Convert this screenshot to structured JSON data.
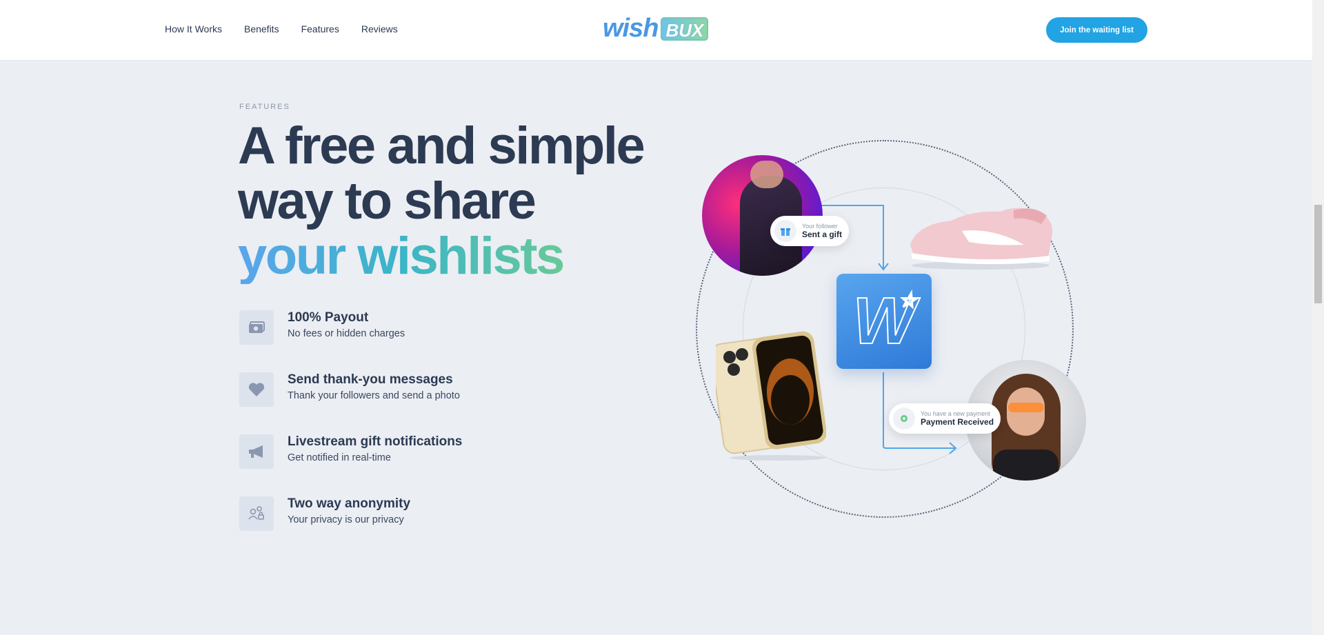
{
  "header": {
    "nav": [
      "How It Works",
      "Benefits",
      "Features",
      "Reviews"
    ],
    "logo": {
      "wish": "wish",
      "bux": "BUX"
    },
    "cta_label": "Join the waiting list"
  },
  "hero": {
    "eyebrow": "FEATURES",
    "headline_line1": "A free and simple",
    "headline_line2": "way to share",
    "headline_line3": "your wishlists"
  },
  "features": [
    {
      "icon": "money-icon",
      "title": "100% Payout",
      "subtitle": "No fees or hidden charges"
    },
    {
      "icon": "heart-icon",
      "title": "Send thank-you messages",
      "subtitle": "Thank your followers and send a photo"
    },
    {
      "icon": "megaphone-icon",
      "title": "Livestream gift notifications",
      "subtitle": "Get notified in real-time"
    },
    {
      "icon": "users-lock-icon",
      "title": "Two way anonymity",
      "subtitle": "Your privacy is our privacy"
    }
  ],
  "illustration": {
    "bubble_gift_small": "Your follower",
    "bubble_gift_big": "Sent a gift",
    "bubble_payment_small": "You have a new payment",
    "bubble_payment_big": "Payment Received",
    "app_letter": "W"
  },
  "colors": {
    "accent": "#21a3e4",
    "heading": "#2c3a52",
    "background": "#ebeef3"
  }
}
